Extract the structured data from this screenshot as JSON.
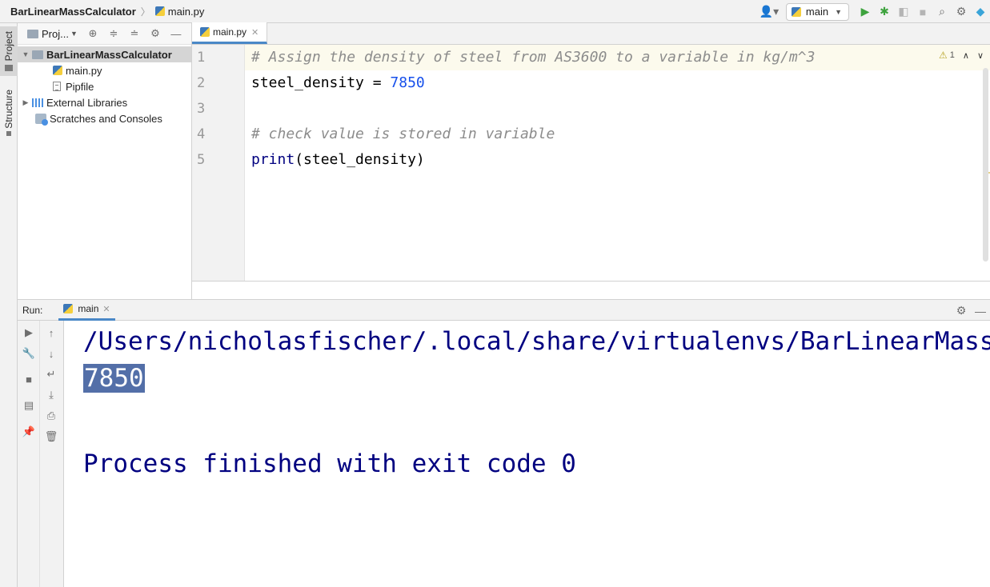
{
  "navbar": {
    "project_name": "BarLinearMassCalculator",
    "current_file": "main.py",
    "run_config": "main"
  },
  "tool_strip": {
    "project_tab": "Project",
    "structure_tab": "Structure"
  },
  "project_panel": {
    "title": "Proj...",
    "tree": {
      "root": "BarLinearMassCalculator",
      "files": [
        "main.py",
        "Pipfile"
      ],
      "external_libraries": "External Libraries",
      "scratches": "Scratches and Consoles"
    }
  },
  "editor": {
    "tab_label": "main.py",
    "inspection_count": "1",
    "line_numbers": [
      "1",
      "2",
      "3",
      "4",
      "5"
    ],
    "lines": {
      "l1_comment": "# Assign the density of steel from AS3600 to a variable in kg/m^3",
      "l2_name": "steel_density = ",
      "l2_value": "7850",
      "l4_comment": "# check value is stored in variable",
      "l5_func": "print",
      "l5_args": "(steel_density)"
    }
  },
  "run": {
    "label": "Run:",
    "tab_label": "main",
    "output": {
      "path_line": "/Users/nicholasfischer/.local/share/virtualenvs/BarLinearMass",
      "value_line": "7850",
      "exit_line": "Process finished with exit code 0"
    }
  },
  "colors": {
    "accent": "#4a88c7",
    "console_text": "#000080",
    "selection": "#536fa8",
    "run_green": "#3ea33e"
  }
}
